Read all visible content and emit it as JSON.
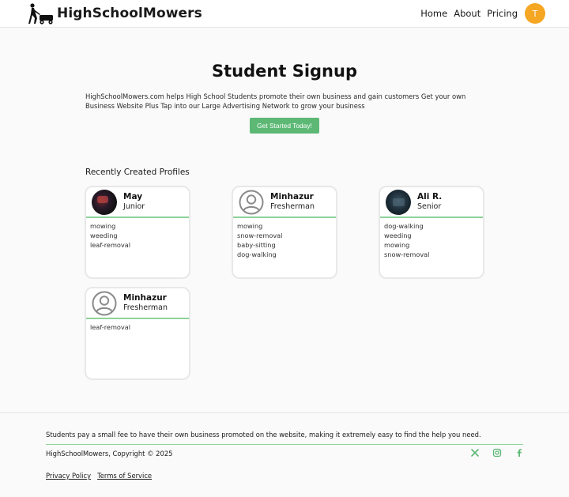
{
  "header": {
    "brand": "HighSchoolMowers",
    "nav": [
      "Home",
      "About",
      "Pricing"
    ],
    "avatar_initial": "T"
  },
  "main": {
    "title": "Student Signup",
    "description": "HighSchoolMowers.com helps High School Students promote their own business and gain customers Get your own Business Website Plus Tap into our Large Advertising Network to grow your business",
    "cta_label": "Get Started Today!",
    "profiles_title": "Recently Created Profiles",
    "profiles": [
      {
        "name": "May",
        "grade": "Junior",
        "tags": [
          "mowing",
          "weeding",
          "leaf-removal"
        ]
      },
      {
        "name": "Minhazur",
        "grade": "Fresherman",
        "tags": [
          "mowing",
          "snow-removal",
          "baby-sitting",
          "dog-walking"
        ]
      },
      {
        "name": "Ali R.",
        "grade": "Senior",
        "tags": [
          "dog-walking",
          "weeding",
          "mowing",
          "snow-removal"
        ]
      },
      {
        "name": "Minhazur",
        "grade": "Fresherman",
        "tags": [
          "leaf-removal"
        ]
      }
    ]
  },
  "footer": {
    "note": "Students pay a small fee to have their own business promoted on the website, making it extremely easy to find the help you need.",
    "copyright": "HighSchoolMowers, Copyright © 2025",
    "social_icons": [
      "x-icon",
      "instagram-icon",
      "facebook-icon"
    ],
    "social_color": "#5cb874",
    "links": [
      "Privacy Policy",
      "Terms of Service"
    ]
  },
  "colors": {
    "accent": "#5cb874",
    "avatar": "#f5a623",
    "card_divider": "#8ed29a"
  }
}
